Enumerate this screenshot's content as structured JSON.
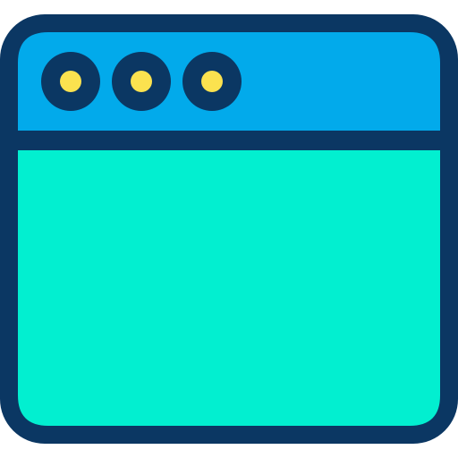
{
  "icon": {
    "name": "browser-window-icon",
    "colors": {
      "outline": "#0b3763",
      "titlebar": "#02aaeb",
      "content": "#02efd0",
      "dot_fill": "#fbe24f"
    },
    "window_control_dots": [
      "dot-1",
      "dot-2",
      "dot-3"
    ]
  }
}
